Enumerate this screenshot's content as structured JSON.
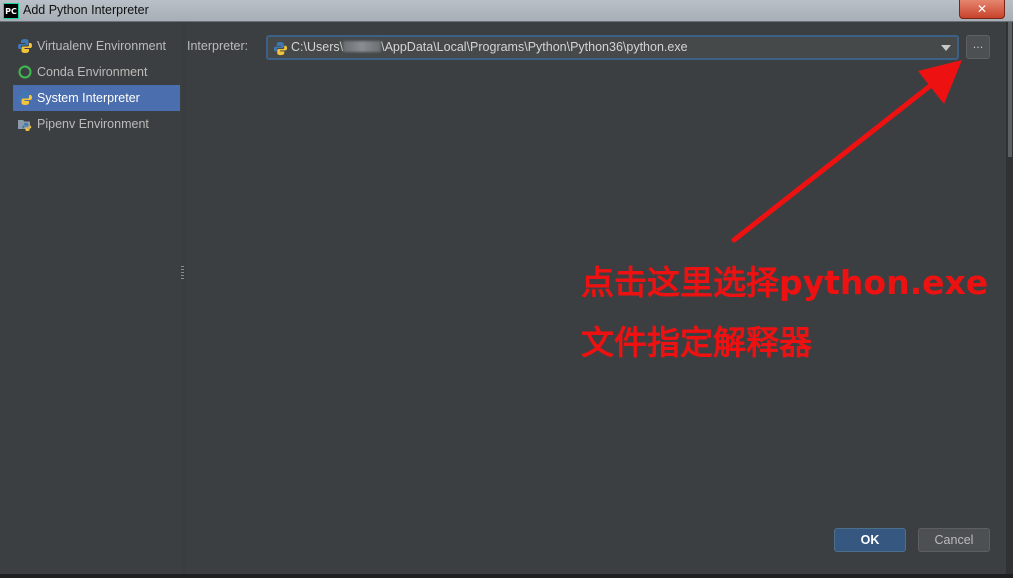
{
  "window": {
    "title": "Add Python Interpreter",
    "app_icon": "PC",
    "close_glyph": "✕"
  },
  "sidebar": {
    "items": [
      {
        "label": "Virtualenv Environment",
        "icon": "python-icon",
        "selected": false
      },
      {
        "label": "Conda Environment",
        "icon": "conda-ring-icon",
        "selected": false
      },
      {
        "label": "System Interpreter",
        "icon": "python-icon",
        "selected": true
      },
      {
        "label": "Pipenv Environment",
        "icon": "pipenv-folder-icon",
        "selected": false
      }
    ]
  },
  "interpreter": {
    "label": "Interpreter:",
    "path_prefix": "C:\\Users\\",
    "path_suffix": "\\AppData\\Local\\Programs\\Python\\Python36\\python.exe",
    "browse_label": "..."
  },
  "buttons": {
    "ok": "OK",
    "cancel": "Cancel"
  },
  "annotation": {
    "line1": "点击这里选择python.exe",
    "line2": "文件指定解释器",
    "color": "#ee1111"
  },
  "colors": {
    "background": "#3c3f41",
    "selection": "#4b6eaf",
    "accent_focus": "#3d6185"
  }
}
